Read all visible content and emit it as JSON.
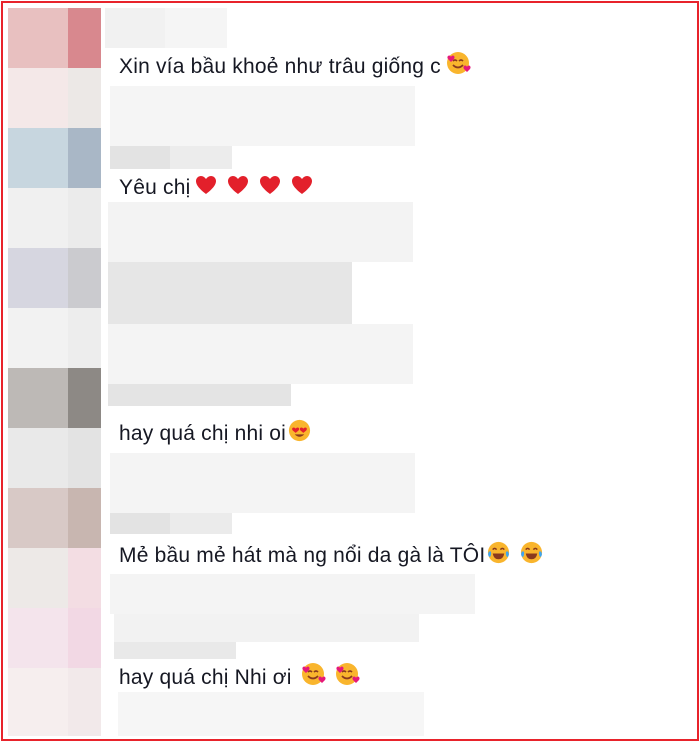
{
  "comments": [
    {
      "text": "Xin vía bầu khoẻ như trâu giống c",
      "emojis": [
        "smiling-face-with-hearts"
      ]
    },
    {
      "text": "Yêu chị",
      "emojis": [
        "red-heart",
        "red-heart",
        "red-heart",
        "red-heart"
      ]
    },
    {
      "text": "hay quá chị nhi oi",
      "emojis": [
        "heart-eyes"
      ]
    },
    {
      "text": "Mẻ bầu mẻ hát mà ng nổi da gà là TÔI",
      "emojis": [
        "tears-of-joy",
        "tears-of-joy"
      ]
    },
    {
      "text": "hay quá chị Nhi ơi",
      "emojis": [
        "smiling-face-with-hearts",
        "smiling-face-with-hearts"
      ]
    }
  ],
  "colors": {
    "frame_border": "#e8232b",
    "text": "#161823",
    "heart": "#e3202b",
    "emoji_face": "#f9b52d",
    "emoji_mouth": "#8a3a1e",
    "emoji_tears": "#3da5f2",
    "emoji_hearts": "#e5197a",
    "placeholder_light": "#f3f3f3",
    "placeholder_mid": "#ececec"
  }
}
